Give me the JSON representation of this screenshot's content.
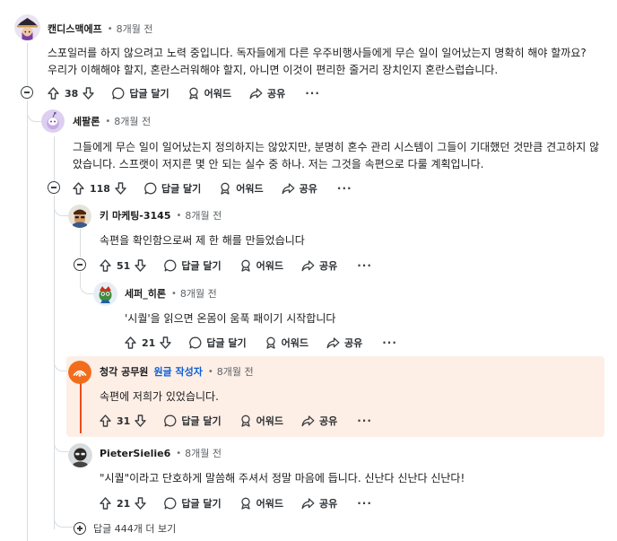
{
  "comments": [
    {
      "author": "캔디스맥에프",
      "time": "8개월 전",
      "body": "스포일러를 하지 않으려고 노력 중입니다. 독자들에게 다른 우주비행사들에게 무슨 일이 일어났는지 명확히 해야 할까요? 우리가 이해해야 할지, 혼란스러워해야 할지, 아니면 이것이 편리한 줄거리 장치인지 혼란스럽습니다.",
      "votes": "38"
    },
    {
      "author": "세팔론",
      "time": "8개월 전",
      "body": "그들에게 무슨 일이 일어났는지 정의하지는 않았지만, 분명히 혼수 관리 시스템이 그들이 기대했던 것만큼 견고하지 않았습니다. 스프랫이 저지른 몇 안 되는 실수 중 하나. 저는 그것을 속편으로 다룰 계획입니다.",
      "votes": "118"
    },
    {
      "author": "키 마케팅-3145",
      "time": "8개월 전",
      "body": "속편을 확인함으로써 제 한 해를 만들었습니다",
      "votes": "51"
    },
    {
      "author": "세퍼_히론",
      "time": "8개월 전",
      "body": "'시퀄'을 읽으면 온몸이 움푹 패이기 시작합니다",
      "votes": "21"
    },
    {
      "author": "청각 공무원",
      "op_badge": "원글 작성자",
      "time": "8개월 전",
      "body": "속편에 저희가 있었습니다.",
      "votes": "31"
    },
    {
      "author": "PieterSielie6",
      "time": "8개월 전",
      "body": "\"시퀄\"이라고 단호하게 말씀해 주셔서 정말 마음에 듭니다. 신난다 신난다 신난다!",
      "votes": "21"
    }
  ],
  "actions": {
    "reply": "답글 달기",
    "award": "어워드",
    "share": "공유",
    "more": "···"
  },
  "separator": "•",
  "more_replies": "답글 444개 더 보기",
  "colors": {
    "op_highlight": "#fdeee6",
    "op_accent": "#e8500f",
    "op_badge": "#0a5fd6"
  }
}
